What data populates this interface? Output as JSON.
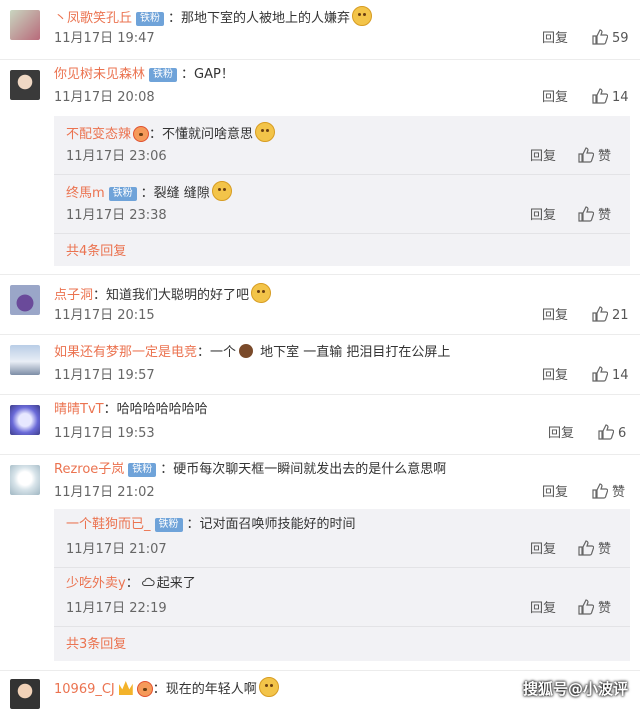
{
  "comments": [
    {
      "user": "丶凤歌笑孔丘",
      "badge": "铁粉",
      "text": "：那地下室的人被地上的人嫌弃",
      "time": "11月17日 19:47",
      "reply": "回复",
      "likes": "59"
    },
    {
      "user": "你见树未见森林",
      "badge": "铁粉",
      "text": "：GAP！",
      "time": "11月17日 20:08",
      "reply": "回复",
      "likes": "14",
      "replies": [
        {
          "user": "不配变态辣",
          "text": "：不懂就问啥意思",
          "time": "11月17日 23:06",
          "reply": "回复",
          "likes": "赞"
        },
        {
          "user": "终馬m",
          "badge": "铁粉",
          "text": "：裂缝 缝隙",
          "time": "11月17日 23:38",
          "reply": "回复",
          "likes": "赞"
        }
      ],
      "more": "共4条回复"
    },
    {
      "user": "点子洞",
      "text": "：知道我们大聪明的好了吧",
      "time": "11月17日 20:15",
      "reply": "回复",
      "likes": "21"
    },
    {
      "user": "如果还有梦那一定是电竞",
      "text_a": "：一个",
      "text_b": " 地下室 一直输 把泪目打在公屏上",
      "time": "11月17日 19:57",
      "reply": "回复",
      "likes": "14"
    },
    {
      "user": "晴晴TvT",
      "text": "：哈哈哈哈哈哈哈",
      "time": "11月17日 19:53",
      "reply": "回复",
      "likes": "6"
    },
    {
      "user": "Rezroe子岚",
      "badge": "铁粉",
      "text": "：硬币每次聊天框一瞬间就发出去的是什么意思啊",
      "time": "11月17日 21:02",
      "reply": "回复",
      "likes": "赞",
      "replies": [
        {
          "user": "一个鞋狗而已_",
          "badge": "铁粉",
          "text": "：记对面召唤师技能好的时间",
          "time": "11月17日 21:07",
          "reply": "回复",
          "likes": "赞"
        },
        {
          "user": "少吃外卖y",
          "text_a": "：",
          "text_b": "起来了",
          "time": "11月17日 22:19",
          "reply": "回复",
          "likes": "赞"
        }
      ],
      "more": "共3条回复"
    },
    {
      "user": "10969_CJ",
      "text": "：现在的年轻人啊"
    }
  ],
  "watermark": "搜狐号@小波评",
  "colors": {
    "username": "#eb7350",
    "badge": "#6fa3d9",
    "subBg": "#f2f2f5"
  },
  "icons": {
    "like": "thumbs-up-icon",
    "emoji": "emoji-face-icon",
    "cloud": "cloud-icon",
    "monkey": "monkey-icon",
    "vip": "vip-crown-icon"
  }
}
